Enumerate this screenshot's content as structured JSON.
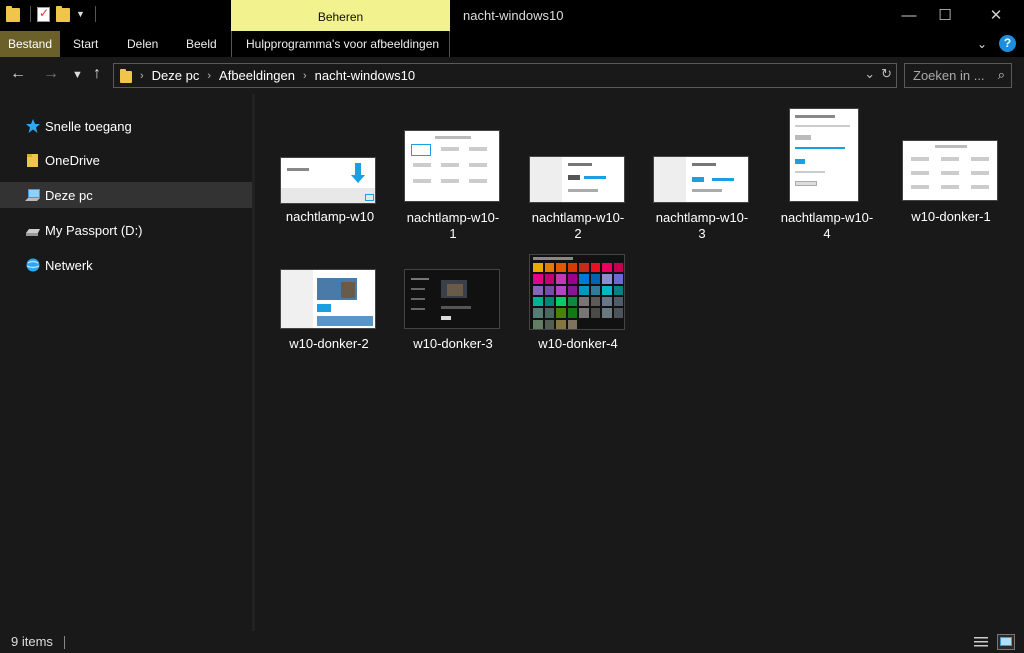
{
  "titlebar": {
    "contextual_tab": "Beheren",
    "window_title": "nacht-windows10",
    "minimize": "—",
    "maximize": "☐",
    "close": "✕"
  },
  "ribbon": {
    "tabs": [
      "Bestand",
      "Start",
      "Delen",
      "Beeld",
      "Hulpprogramma's voor afbeeldingen"
    ]
  },
  "address": {
    "crumbs": [
      "Deze pc",
      "Afbeeldingen",
      "nacht-windows10"
    ],
    "search_placeholder": "Zoeken in ..."
  },
  "sidebar": {
    "items": [
      {
        "label": "Snelle toegang",
        "icon": "star-icon"
      },
      {
        "label": "OneDrive",
        "icon": "folder-icon"
      },
      {
        "label": "Deze pc",
        "icon": "computer-icon"
      },
      {
        "label": "My Passport (D:)",
        "icon": "drive-icon"
      },
      {
        "label": "Netwerk",
        "icon": "network-icon"
      }
    ]
  },
  "files": [
    {
      "name": "nachtlamp-w10",
      "l1": "nachtlamp-w10",
      "l2": ""
    },
    {
      "name": "nachtlamp-w10-1",
      "l1": "nachtlamp-w10-",
      "l2": "1"
    },
    {
      "name": "nachtlamp-w10-2",
      "l1": "nachtlamp-w10-",
      "l2": "2"
    },
    {
      "name": "nachtlamp-w10-3",
      "l1": "nachtlamp-w10-",
      "l2": "3"
    },
    {
      "name": "nachtlamp-w10-4",
      "l1": "nachtlamp-w10-",
      "l2": "4"
    },
    {
      "name": "w10-donker-1",
      "l1": "w10-donker-1",
      "l2": ""
    },
    {
      "name": "w10-donker-2",
      "l1": "w10-donker-2",
      "l2": ""
    },
    {
      "name": "w10-donker-3",
      "l1": "w10-donker-3",
      "l2": ""
    },
    {
      "name": "w10-donker-4",
      "l1": "w10-donker-4",
      "l2": ""
    }
  ],
  "status": {
    "item_count": "9 items"
  },
  "colors": {
    "accent_yellow": "#f2f28f",
    "file_tab": "#6b5f2a",
    "arrow_blue": "#1a9fe0"
  }
}
